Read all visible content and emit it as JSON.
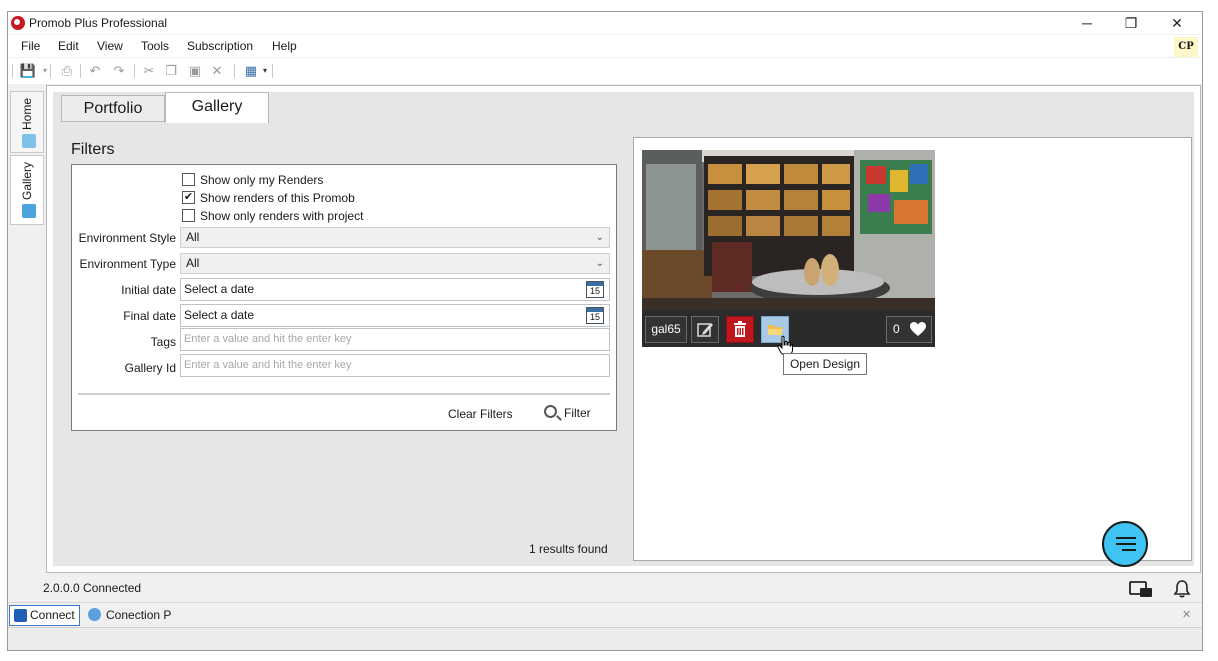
{
  "window": {
    "title": "Promob Plus Professional",
    "minimize": "─",
    "restore": "❐",
    "close": "✕"
  },
  "menu": [
    "File",
    "Edit",
    "View",
    "Tools",
    "Subscription",
    "Help"
  ],
  "user_badge": "CP",
  "side_tabs": {
    "home": "Home",
    "gallery": "Gallery"
  },
  "tabs": {
    "portfolio": "Portfolio",
    "gallery": "Gallery"
  },
  "filters": {
    "title": "Filters",
    "checkboxes": [
      {
        "label": "Show only my Renders",
        "checked": false
      },
      {
        "label": "Show renders of this Promob",
        "checked": true
      },
      {
        "label": "Show only renders with project",
        "checked": false
      }
    ],
    "environment_style": {
      "label": "Environment Style",
      "value": "All"
    },
    "environment_type": {
      "label": "Environment Type",
      "value": "All"
    },
    "initial_date": {
      "label": "Initial date",
      "value": "Select a date",
      "cal": "15"
    },
    "final_date": {
      "label": "Final date",
      "value": "Select a date",
      "cal": "15"
    },
    "tags": {
      "label": "Tags",
      "placeholder": "Enter a value and hit the enter key"
    },
    "gallery_id": {
      "label": "Gallery Id",
      "placeholder": "Enter a value and hit the enter key"
    },
    "clear_label": "Clear Filters",
    "filter_label": "Filter",
    "results": "1 results found"
  },
  "card": {
    "id": "gal65",
    "likes": "0",
    "tooltip": "Open Design"
  },
  "status": {
    "text": "2.0.0.0  Connected",
    "connect": "Connect",
    "connection": "Conection P",
    "close": "✕"
  },
  "colors": {
    "accent": "#3fc3f2",
    "delete": "#c0161d",
    "open_highlight": "#a9c9e6"
  }
}
